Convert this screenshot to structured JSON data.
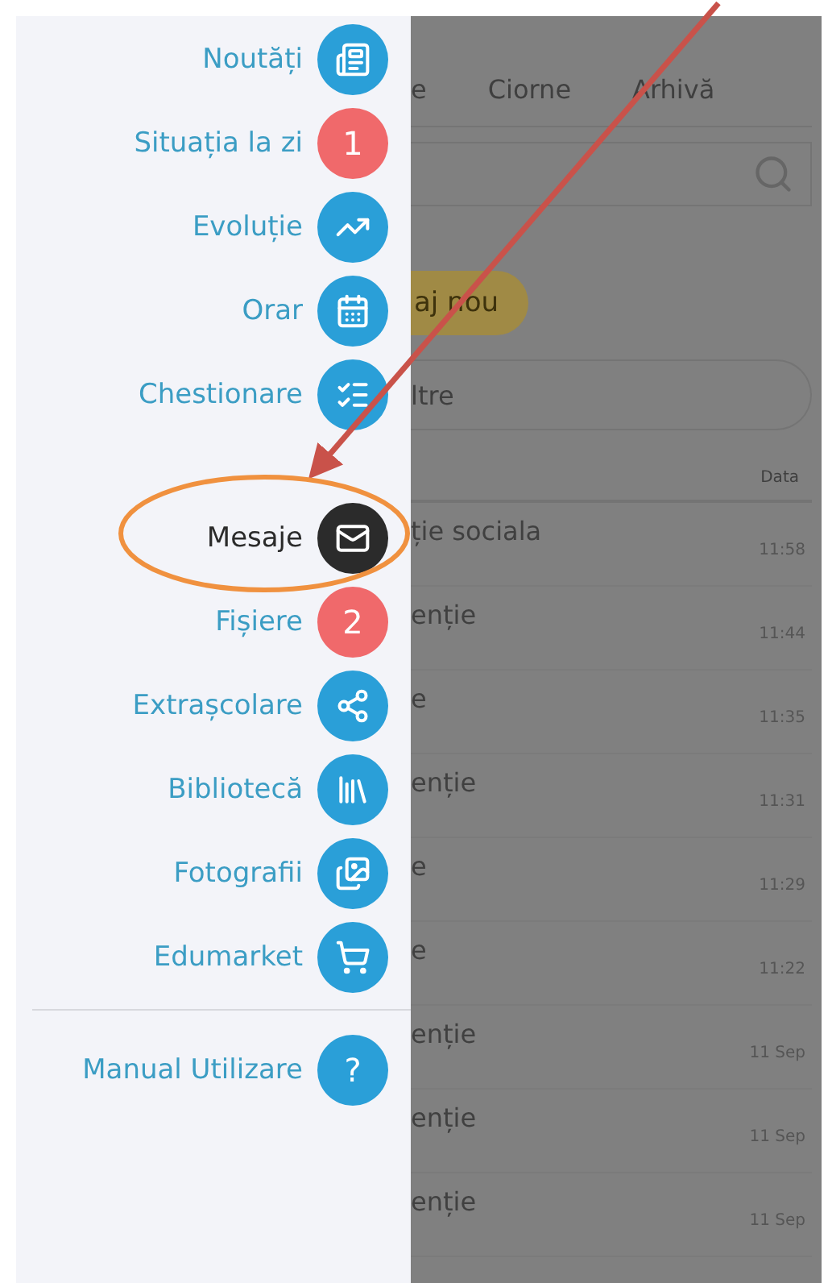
{
  "menu": {
    "sections": [
      {
        "items": [
          {
            "label": "Noutăți",
            "kind": "icon",
            "selected": false
          },
          {
            "label": "Situația la zi",
            "kind": "badge",
            "badge": "1",
            "selected": false
          },
          {
            "label": "Evoluție",
            "kind": "icon",
            "selected": false
          },
          {
            "label": "Orar",
            "kind": "icon",
            "selected": false
          },
          {
            "label": "Chestionare",
            "kind": "icon",
            "selected": false
          }
        ]
      },
      {
        "items": [
          {
            "label": "Mesaje",
            "kind": "icon",
            "selected": true
          },
          {
            "label": "Fișiere",
            "kind": "badge",
            "badge": "2",
            "selected": false
          },
          {
            "label": "Extrașcolare",
            "kind": "icon",
            "selected": false
          },
          {
            "label": "Bibliotecă",
            "kind": "icon",
            "selected": false
          },
          {
            "label": "Fotografii",
            "kind": "icon",
            "selected": false
          },
          {
            "label": "Edumarket",
            "kind": "icon",
            "selected": false
          }
        ]
      }
    ],
    "footer": {
      "label": "Manual Utilizare",
      "kind": "glyph",
      "glyph": "?",
      "selected": false
    }
  },
  "main": {
    "tabs": [
      {
        "label": "e"
      },
      {
        "label": "Ciorne"
      },
      {
        "label": "Arhivă"
      }
    ],
    "new_button": "aj nou",
    "filter": "ltre",
    "date_header": "Data",
    "rows": [
      {
        "subject": "ție sociala",
        "time": "11:58"
      },
      {
        "subject": "enție",
        "time": "11:44"
      },
      {
        "subject": "e",
        "time": "11:35"
      },
      {
        "subject": "enție",
        "time": "11:31"
      },
      {
        "subject": "e",
        "time": "11:29"
      },
      {
        "subject": "e",
        "time": "11:22"
      },
      {
        "subject": "enție",
        "time": "11 Sep"
      },
      {
        "subject": "enție",
        "time": "11 Sep"
      },
      {
        "subject": "enție",
        "time": "11 Sep"
      }
    ]
  }
}
